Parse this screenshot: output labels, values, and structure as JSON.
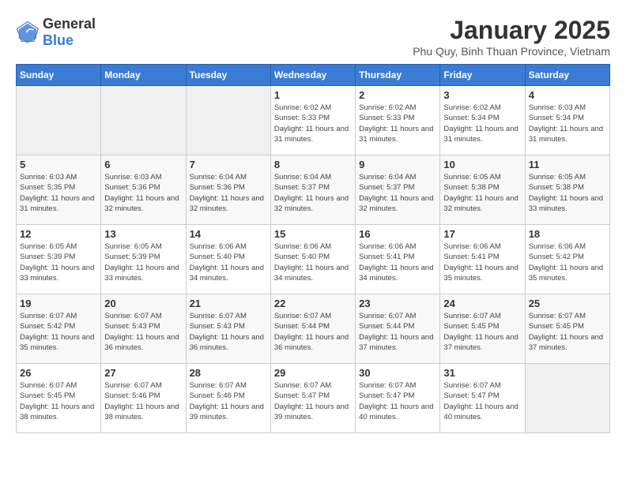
{
  "logo": {
    "text_general": "General",
    "text_blue": "Blue"
  },
  "title": "January 2025",
  "subtitle": "Phu Quy, Binh Thuan Province, Vietnam",
  "days_of_week": [
    "Sunday",
    "Monday",
    "Tuesday",
    "Wednesday",
    "Thursday",
    "Friday",
    "Saturday"
  ],
  "weeks": [
    [
      {
        "day": "",
        "info": ""
      },
      {
        "day": "",
        "info": ""
      },
      {
        "day": "",
        "info": ""
      },
      {
        "day": "1",
        "info": "Sunrise: 6:02 AM\nSunset: 5:33 PM\nDaylight: 11 hours and 31 minutes."
      },
      {
        "day": "2",
        "info": "Sunrise: 6:02 AM\nSunset: 5:33 PM\nDaylight: 11 hours and 31 minutes."
      },
      {
        "day": "3",
        "info": "Sunrise: 6:02 AM\nSunset: 5:34 PM\nDaylight: 11 hours and 31 minutes."
      },
      {
        "day": "4",
        "info": "Sunrise: 6:03 AM\nSunset: 5:34 PM\nDaylight: 11 hours and 31 minutes."
      }
    ],
    [
      {
        "day": "5",
        "info": "Sunrise: 6:03 AM\nSunset: 5:35 PM\nDaylight: 11 hours and 31 minutes."
      },
      {
        "day": "6",
        "info": "Sunrise: 6:03 AM\nSunset: 5:36 PM\nDaylight: 11 hours and 32 minutes."
      },
      {
        "day": "7",
        "info": "Sunrise: 6:04 AM\nSunset: 5:36 PM\nDaylight: 11 hours and 32 minutes."
      },
      {
        "day": "8",
        "info": "Sunrise: 6:04 AM\nSunset: 5:37 PM\nDaylight: 11 hours and 32 minutes."
      },
      {
        "day": "9",
        "info": "Sunrise: 6:04 AM\nSunset: 5:37 PM\nDaylight: 11 hours and 32 minutes."
      },
      {
        "day": "10",
        "info": "Sunrise: 6:05 AM\nSunset: 5:38 PM\nDaylight: 11 hours and 32 minutes."
      },
      {
        "day": "11",
        "info": "Sunrise: 6:05 AM\nSunset: 5:38 PM\nDaylight: 11 hours and 33 minutes."
      }
    ],
    [
      {
        "day": "12",
        "info": "Sunrise: 6:05 AM\nSunset: 5:39 PM\nDaylight: 11 hours and 33 minutes."
      },
      {
        "day": "13",
        "info": "Sunrise: 6:05 AM\nSunset: 5:39 PM\nDaylight: 11 hours and 33 minutes."
      },
      {
        "day": "14",
        "info": "Sunrise: 6:06 AM\nSunset: 5:40 PM\nDaylight: 11 hours and 34 minutes."
      },
      {
        "day": "15",
        "info": "Sunrise: 6:06 AM\nSunset: 5:40 PM\nDaylight: 11 hours and 34 minutes."
      },
      {
        "day": "16",
        "info": "Sunrise: 6:06 AM\nSunset: 5:41 PM\nDaylight: 11 hours and 34 minutes."
      },
      {
        "day": "17",
        "info": "Sunrise: 6:06 AM\nSunset: 5:41 PM\nDaylight: 11 hours and 35 minutes."
      },
      {
        "day": "18",
        "info": "Sunrise: 6:06 AM\nSunset: 5:42 PM\nDaylight: 11 hours and 35 minutes."
      }
    ],
    [
      {
        "day": "19",
        "info": "Sunrise: 6:07 AM\nSunset: 5:42 PM\nDaylight: 11 hours and 35 minutes."
      },
      {
        "day": "20",
        "info": "Sunrise: 6:07 AM\nSunset: 5:43 PM\nDaylight: 11 hours and 36 minutes."
      },
      {
        "day": "21",
        "info": "Sunrise: 6:07 AM\nSunset: 5:43 PM\nDaylight: 11 hours and 36 minutes."
      },
      {
        "day": "22",
        "info": "Sunrise: 6:07 AM\nSunset: 5:44 PM\nDaylight: 11 hours and 36 minutes."
      },
      {
        "day": "23",
        "info": "Sunrise: 6:07 AM\nSunset: 5:44 PM\nDaylight: 11 hours and 37 minutes."
      },
      {
        "day": "24",
        "info": "Sunrise: 6:07 AM\nSunset: 5:45 PM\nDaylight: 11 hours and 37 minutes."
      },
      {
        "day": "25",
        "info": "Sunrise: 6:07 AM\nSunset: 5:45 PM\nDaylight: 11 hours and 37 minutes."
      }
    ],
    [
      {
        "day": "26",
        "info": "Sunrise: 6:07 AM\nSunset: 5:45 PM\nDaylight: 11 hours and 38 minutes."
      },
      {
        "day": "27",
        "info": "Sunrise: 6:07 AM\nSunset: 5:46 PM\nDaylight: 11 hours and 38 minutes."
      },
      {
        "day": "28",
        "info": "Sunrise: 6:07 AM\nSunset: 5:46 PM\nDaylight: 11 hours and 39 minutes."
      },
      {
        "day": "29",
        "info": "Sunrise: 6:07 AM\nSunset: 5:47 PM\nDaylight: 11 hours and 39 minutes."
      },
      {
        "day": "30",
        "info": "Sunrise: 6:07 AM\nSunset: 5:47 PM\nDaylight: 11 hours and 40 minutes."
      },
      {
        "day": "31",
        "info": "Sunrise: 6:07 AM\nSunset: 5:47 PM\nDaylight: 11 hours and 40 minutes."
      },
      {
        "day": "",
        "info": ""
      }
    ]
  ]
}
